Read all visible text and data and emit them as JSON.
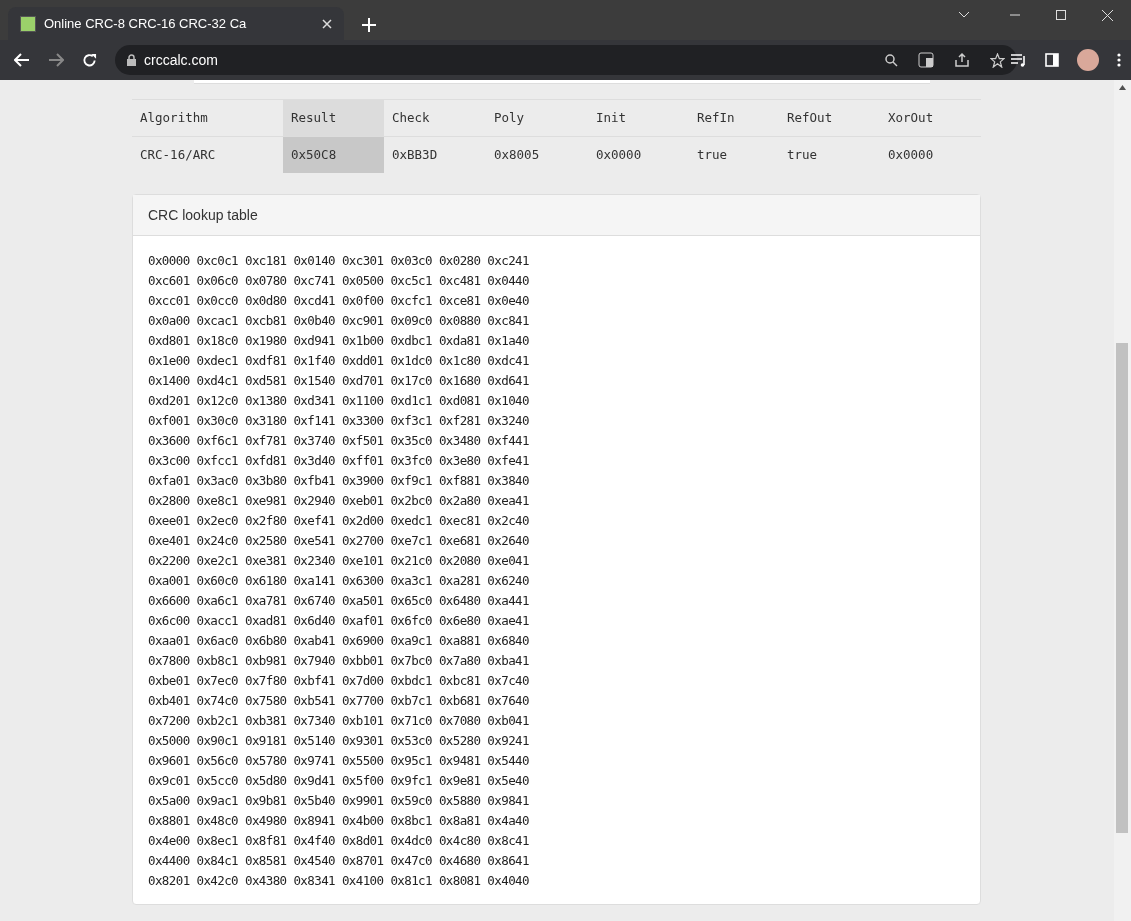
{
  "browser": {
    "tab_title": "Online CRC-8 CRC-16 CRC-32 Ca",
    "address": "crccalc.com"
  },
  "result_table": {
    "columns": [
      {
        "label": "Algorithm",
        "highlighted": false
      },
      {
        "label": "Result",
        "highlighted": true
      },
      {
        "label": "Check",
        "highlighted": false
      },
      {
        "label": "Poly",
        "highlighted": false
      },
      {
        "label": "Init",
        "highlighted": false
      },
      {
        "label": "RefIn",
        "highlighted": false
      },
      {
        "label": "RefOut",
        "highlighted": false
      },
      {
        "label": "XorOut",
        "highlighted": false
      }
    ],
    "rows": [
      [
        "CRC-16/ARC",
        "0x50C8",
        "0xBB3D",
        "0x8005",
        "0x0000",
        "true",
        "true",
        "0x0000"
      ]
    ]
  },
  "lookup_table": {
    "title": "CRC lookup table",
    "lines": [
      "0x0000 0xc0c1 0xc181 0x0140 0xc301 0x03c0 0x0280 0xc241",
      "0xc601 0x06c0 0x0780 0xc741 0x0500 0xc5c1 0xc481 0x0440",
      "0xcc01 0x0cc0 0x0d80 0xcd41 0x0f00 0xcfc1 0xce81 0x0e40",
      "0x0a00 0xcac1 0xcb81 0x0b40 0xc901 0x09c0 0x0880 0xc841",
      "0xd801 0x18c0 0x1980 0xd941 0x1b00 0xdbc1 0xda81 0x1a40",
      "0x1e00 0xdec1 0xdf81 0x1f40 0xdd01 0x1dc0 0x1c80 0xdc41",
      "0x1400 0xd4c1 0xd581 0x1540 0xd701 0x17c0 0x1680 0xd641",
      "0xd201 0x12c0 0x1380 0xd341 0x1100 0xd1c1 0xd081 0x1040",
      "0xf001 0x30c0 0x3180 0xf141 0x3300 0xf3c1 0xf281 0x3240",
      "0x3600 0xf6c1 0xf781 0x3740 0xf501 0x35c0 0x3480 0xf441",
      "0x3c00 0xfcc1 0xfd81 0x3d40 0xff01 0x3fc0 0x3e80 0xfe41",
      "0xfa01 0x3ac0 0x3b80 0xfb41 0x3900 0xf9c1 0xf881 0x3840",
      "0x2800 0xe8c1 0xe981 0x2940 0xeb01 0x2bc0 0x2a80 0xea41",
      "0xee01 0x2ec0 0x2f80 0xef41 0x2d00 0xedc1 0xec81 0x2c40",
      "0xe401 0x24c0 0x2580 0xe541 0x2700 0xe7c1 0xe681 0x2640",
      "0x2200 0xe2c1 0xe381 0x2340 0xe101 0x21c0 0x2080 0xe041",
      "0xa001 0x60c0 0x6180 0xa141 0x6300 0xa3c1 0xa281 0x6240",
      "0x6600 0xa6c1 0xa781 0x6740 0xa501 0x65c0 0x6480 0xa441",
      "0x6c00 0xacc1 0xad81 0x6d40 0xaf01 0x6fc0 0x6e80 0xae41",
      "0xaa01 0x6ac0 0x6b80 0xab41 0x6900 0xa9c1 0xa881 0x6840",
      "0x7800 0xb8c1 0xb981 0x7940 0xbb01 0x7bc0 0x7a80 0xba41",
      "0xbe01 0x7ec0 0x7f80 0xbf41 0x7d00 0xbdc1 0xbc81 0x7c40",
      "0xb401 0x74c0 0x7580 0xb541 0x7700 0xb7c1 0xb681 0x7640",
      "0x7200 0xb2c1 0xb381 0x7340 0xb101 0x71c0 0x7080 0xb041",
      "0x5000 0x90c1 0x9181 0x5140 0x9301 0x53c0 0x5280 0x9241",
      "0x9601 0x56c0 0x5780 0x9741 0x5500 0x95c1 0x9481 0x5440",
      "0x9c01 0x5cc0 0x5d80 0x9d41 0x5f00 0x9fc1 0x9e81 0x5e40",
      "0x5a00 0x9ac1 0x9b81 0x5b40 0x9901 0x59c0 0x5880 0x9841",
      "0x8801 0x48c0 0x4980 0x8941 0x4b00 0x8bc1 0x8a81 0x4a40",
      "0x4e00 0x8ec1 0x8f81 0x4f40 0x8d01 0x4dc0 0x4c80 0x8c41",
      "0x4400 0x84c1 0x8581 0x4540 0x8701 0x47c0 0x4680 0x8641",
      "0x8201 0x42c0 0x4380 0x8341 0x4100 0x81c1 0x8081 0x4040"
    ]
  }
}
